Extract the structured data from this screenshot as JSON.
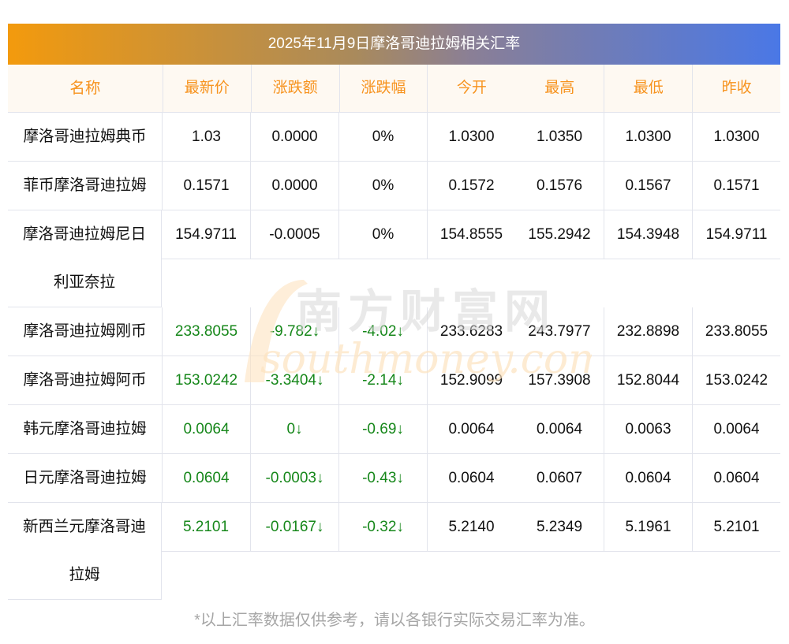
{
  "title": "2025年11月9日摩洛哥迪拉姆相关汇率",
  "headers": [
    "名称",
    "最新价",
    "涨跌额",
    "涨跌幅",
    "今开",
    "最高",
    "最低",
    "昨收"
  ],
  "rows": [
    {
      "name": "摩洛哥迪拉姆典币",
      "latest": "1.03",
      "change": "0.0000",
      "pct": "0%",
      "open": "1.0300",
      "high": "1.0350",
      "low": "1.0300",
      "prev": "1.0300"
    },
    {
      "name": "菲币摩洛哥迪拉姆",
      "latest": "0.1571",
      "change": "0.0000",
      "pct": "0%",
      "open": "0.1572",
      "high": "0.1576",
      "low": "0.1567",
      "prev": "0.1571"
    },
    {
      "name": "摩洛哥迪拉姆尼日利亚奈拉",
      "latest": "154.9711",
      "change": "-0.0005",
      "pct": "0%",
      "open": "154.8555",
      "high": "155.2942",
      "low": "154.3948",
      "prev": "154.9711"
    },
    {
      "name": "摩洛哥迪拉姆刚币",
      "latest": "233.8055",
      "change": "-9.782↓",
      "pct": "-4.02↓",
      "open": "233.6283",
      "high": "243.7977",
      "low": "232.8898",
      "prev": "233.8055"
    },
    {
      "name": "摩洛哥迪拉姆阿币",
      "latest": "153.0242",
      "change": "-3.3404↓",
      "pct": "-2.14↓",
      "open": "152.9099",
      "high": "157.3908",
      "low": "152.8044",
      "prev": "153.0242"
    },
    {
      "name": "韩元摩洛哥迪拉姆",
      "latest": "0.0064",
      "change": "0↓",
      "pct": "-0.69↓",
      "open": "0.0064",
      "high": "0.0064",
      "low": "0.0063",
      "prev": "0.0064"
    },
    {
      "name": "日元摩洛哥迪拉姆",
      "latest": "0.0604",
      "change": "-0.0003↓",
      "pct": "-0.43↓",
      "open": "0.0604",
      "high": "0.0607",
      "low": "0.0604",
      "prev": "0.0604"
    },
    {
      "name": "新西兰元摩洛哥迪拉姆",
      "latest": "5.2101",
      "change": "-0.0167↓",
      "pct": "-0.32↓",
      "open": "5.2140",
      "high": "5.2349",
      "low": "5.1961",
      "prev": "5.2101"
    }
  ],
  "watermark": {
    "cn": "南方财富网",
    "en": "southmoney.com"
  },
  "note": "*以上汇率数据仅供参考，请以各银行实际交易汇率为准。",
  "colors": {
    "header_text": "#f7931e",
    "down": "#16871a",
    "header_bg": "#fef9f2"
  }
}
